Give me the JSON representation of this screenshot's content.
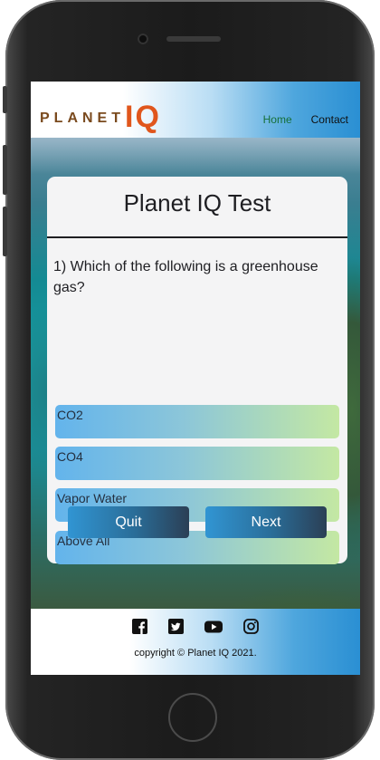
{
  "brand": {
    "name_part1": "PLANET",
    "name_part2": "IQ",
    "color_primary": "#e0561c",
    "color_secondary": "#7a4a1e"
  },
  "nav": {
    "items": [
      {
        "label": "Home",
        "active": true
      },
      {
        "label": "Contact",
        "active": false
      }
    ]
  },
  "quiz": {
    "title": "Planet IQ Test",
    "question": "1) Which of the following is a greenhouse gas?",
    "options": [
      "CO2",
      "CO4",
      "Vapor Water",
      "Above All"
    ],
    "quit_label": "Quit",
    "next_label": "Next"
  },
  "footer": {
    "social_icons": [
      "facebook-icon",
      "twitter-icon",
      "youtube-icon",
      "instagram-icon"
    ],
    "copyright": "copyright © Planet IQ 2021."
  }
}
